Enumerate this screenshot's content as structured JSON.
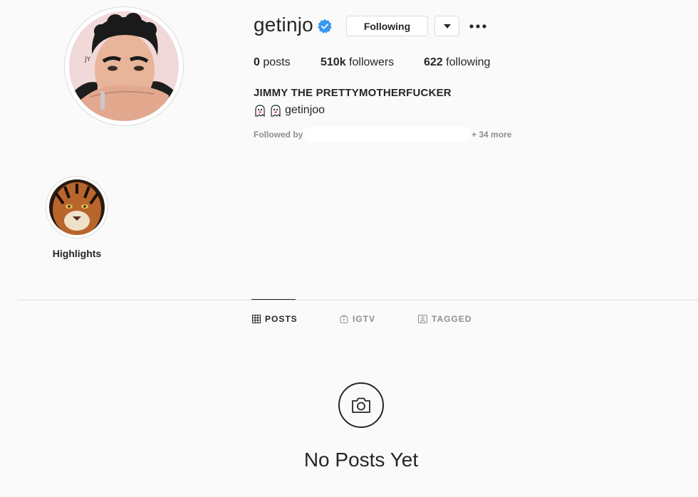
{
  "profile": {
    "username": "getinjo",
    "verified_icon": "verified-badge-icon",
    "following_label": "Following",
    "posts_count": "0",
    "posts_label": "posts",
    "followers_count": "510k",
    "followers_label": "followers",
    "following_count": "622",
    "following_word": "following",
    "full_name": "JIMMY THE PRETTYMOTHERFUCKER",
    "bio_text": "getinjoo",
    "followed_by_label": "Followed by",
    "followed_by_more": "+ 34 more"
  },
  "highlights": [
    {
      "label": "Highlights"
    }
  ],
  "tabs": [
    {
      "label": "POSTS",
      "icon": "grid-icon",
      "active": true
    },
    {
      "label": "IGTV",
      "icon": "igtv-icon",
      "active": false
    },
    {
      "label": "TAGGED",
      "icon": "tagged-icon",
      "active": false
    }
  ],
  "empty_state": {
    "icon": "camera-icon",
    "text": "No Posts Yet"
  },
  "colors": {
    "background": "#fafafa",
    "text": "#262626",
    "muted": "#8e8e8e",
    "border": "#dbdbdb",
    "verified": "#3897f0"
  }
}
